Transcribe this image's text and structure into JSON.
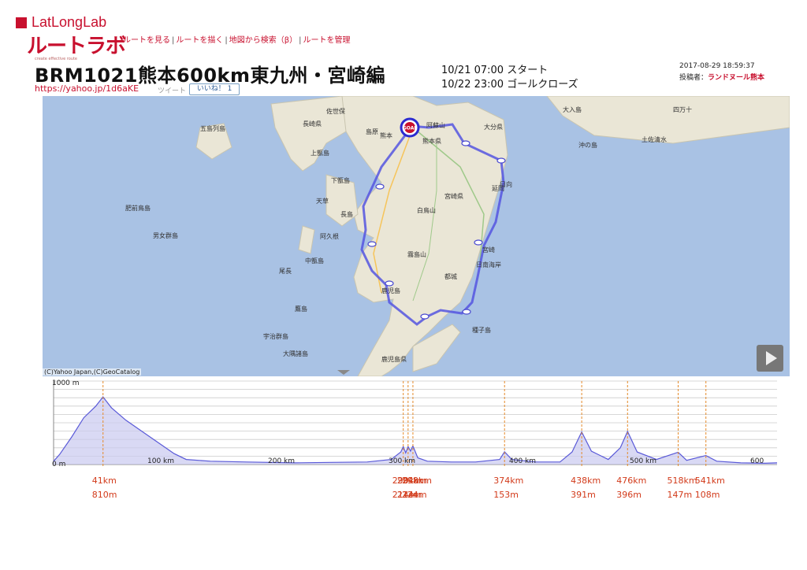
{
  "header": {
    "logo_top": "LatLongLab",
    "logo_main": "ルートラボ",
    "logo_tagline": "create effective route",
    "nav": [
      "ルートを見る",
      "ルートを描く",
      "地図から検索（β）",
      "ルートを管理"
    ],
    "nav_sep": "|",
    "title": "BRM1021熊本600km東九州・宮崎編",
    "short_url": "https://yahoo.jp/1d6aKE",
    "tweet_label": "ツイート",
    "like_label": "いいね！ 1",
    "start": "10/21 07:00 スタート",
    "close": "10/22 23:00 ゴールクローズ",
    "posted_at": "2017-08-29 18:59:37",
    "poster_label": "投稿者：",
    "poster_name": "ランドヌール熊本"
  },
  "map": {
    "copyright": "(C)Yahoo Japan,(C)GeoCatalog",
    "play_icon": "play-icon",
    "goal_label": "GOAL",
    "labels": [
      {
        "t": "長崎県"
      },
      {
        "t": "熊本"
      },
      {
        "t": "熊本県"
      },
      {
        "t": "大分県"
      },
      {
        "t": "宮崎県"
      },
      {
        "t": "鹿児島"
      },
      {
        "t": "鹿児島県"
      },
      {
        "t": "宮崎"
      },
      {
        "t": "阿蘇山"
      },
      {
        "t": "五島列島"
      },
      {
        "t": "上甑島"
      },
      {
        "t": "下甑島"
      },
      {
        "t": "男女群島"
      },
      {
        "t": "肥前鳥島"
      },
      {
        "t": "天草"
      },
      {
        "t": "長島"
      },
      {
        "t": "阿久根"
      },
      {
        "t": "中甑島"
      },
      {
        "t": "尾長"
      },
      {
        "t": "鷹島"
      },
      {
        "t": "宇治群島"
      },
      {
        "t": "大隅諸島"
      },
      {
        "t": "種子島"
      },
      {
        "t": "土佐清水"
      },
      {
        "t": "沖の島"
      },
      {
        "t": "日南海岸"
      },
      {
        "t": "都城"
      },
      {
        "t": "霧島山"
      },
      {
        "t": "白鳥山"
      },
      {
        "t": "延岡"
      },
      {
        "t": "佐世保"
      },
      {
        "t": "島原"
      },
      {
        "t": "日向"
      },
      {
        "t": "大入島"
      },
      {
        "t": "四万十"
      }
    ]
  },
  "elevation": {
    "y_max_label": "1000 m",
    "y_min_label": "0 m",
    "x_ticks": [
      "100 km",
      "200 km",
      "300 km",
      "400 km",
      "500 km",
      "600"
    ],
    "markers": [
      {
        "km": "41km",
        "elev": "810m"
      },
      {
        "km": "290km",
        "elev": "214m"
      },
      {
        "km": "294km",
        "elev": "214m"
      },
      {
        "km": "298km",
        "elev": "224m"
      },
      {
        "km": "374km",
        "elev": "153m"
      },
      {
        "km": "438km",
        "elev": "391m"
      },
      {
        "km": "476km",
        "elev": "396m"
      },
      {
        "km": "518km",
        "elev": "147m"
      },
      {
        "km": "541km",
        "elev": "108m"
      }
    ],
    "marker_values_km": [
      41,
      290,
      294,
      298,
      374,
      438,
      476,
      518,
      541
    ],
    "marker_values_m": [
      810,
      214,
      214,
      224,
      153,
      391,
      396,
      147,
      108
    ],
    "profile_km": [
      0,
      5,
      15,
      25,
      35,
      41,
      48,
      60,
      75,
      90,
      100,
      110,
      130,
      160,
      200,
      230,
      260,
      280,
      288,
      290,
      292,
      294,
      296,
      298,
      302,
      310,
      330,
      350,
      370,
      374,
      380,
      400,
      420,
      430,
      438,
      446,
      460,
      470,
      476,
      484,
      500,
      518,
      525,
      541,
      550,
      570,
      590,
      600
    ],
    "profile_m": [
      40,
      120,
      330,
      560,
      700,
      810,
      680,
      530,
      380,
      230,
      130,
      60,
      40,
      30,
      20,
      25,
      30,
      60,
      150,
      214,
      140,
      214,
      160,
      224,
      80,
      40,
      30,
      30,
      60,
      153,
      60,
      30,
      30,
      150,
      391,
      160,
      60,
      200,
      396,
      150,
      60,
      147,
      50,
      108,
      40,
      20,
      15,
      20
    ],
    "km_max": 600,
    "m_max": 1000,
    "line_color": "#5a5ad8",
    "fill_color": "#c9c9ef",
    "marker_color": "#e48a2a"
  }
}
